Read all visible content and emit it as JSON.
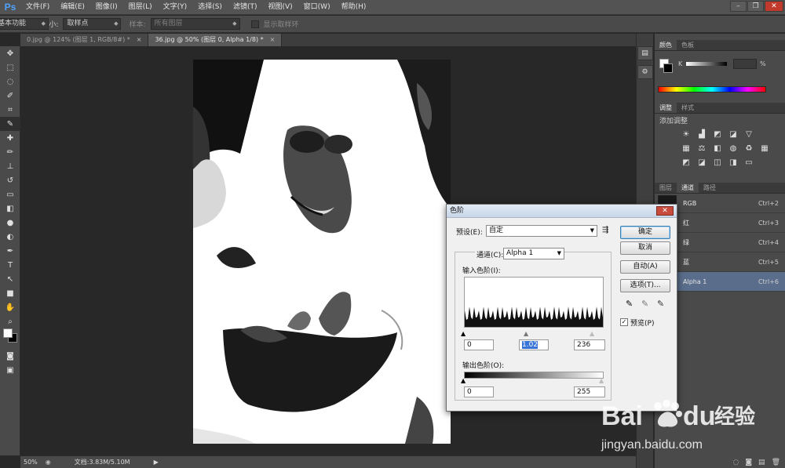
{
  "app": {
    "logo": "Ps"
  },
  "menu": [
    "文件(F)",
    "编辑(E)",
    "图像(I)",
    "图层(L)",
    "文字(Y)",
    "选择(S)",
    "滤镜(T)",
    "视图(V)",
    "窗口(W)",
    "帮助(H)"
  ],
  "options": {
    "sample_size_label": "取样大小:",
    "sample_size_value": "取样点",
    "sample_label": "样本:",
    "sample_value": "所有图层",
    "show_ring_label": "显示取样环",
    "workspace": "基本功能"
  },
  "tabs": [
    {
      "label": "0.jpg @ 124% (图层 1, RGB/8#) *",
      "active": false
    },
    {
      "label": "36.jpg @ 50% (图层 0, Alpha 1/8) *",
      "active": true
    }
  ],
  "status": {
    "zoom": "50%",
    "doc": "文档:3.83M/5.10M"
  },
  "panels": {
    "color_tabs": [
      "颜色",
      "色板"
    ],
    "color_k_label": "K",
    "color_k_percent": "%",
    "adjust_tabs": [
      "调整",
      "样式"
    ],
    "adjust_title": "添加调整",
    "layer_tabs": [
      "图层",
      "通道",
      "路径"
    ],
    "channels": [
      {
        "name": "RGB",
        "shortcut": "Ctrl+2",
        "active": false
      },
      {
        "name": "红",
        "shortcut": "Ctrl+3",
        "active": false
      },
      {
        "name": "绿",
        "shortcut": "Ctrl+4",
        "active": false
      },
      {
        "name": "蓝",
        "shortcut": "Ctrl+5",
        "active": false
      },
      {
        "name": "Alpha 1",
        "shortcut": "Ctrl+6",
        "active": true
      }
    ]
  },
  "levels": {
    "title": "色阶",
    "preset_label": "预设(E):",
    "preset_value": "自定",
    "channel_label": "通道(C):",
    "channel_value": "Alpha 1",
    "input_label": "输入色阶(I):",
    "input_black": "0",
    "input_gamma": "1.02",
    "input_white": "236",
    "output_label": "输出色阶(O):",
    "output_black": "0",
    "output_white": "255",
    "ok": "确定",
    "cancel": "取消",
    "auto": "自动(A)",
    "options": "选项(T)...",
    "preview": "预览(P)",
    "preview_checked": true
  },
  "watermark": {
    "brand": "Bai",
    "brand_suffix": "du",
    "cn": "经验",
    "url": "jingyan.baidu.com"
  }
}
